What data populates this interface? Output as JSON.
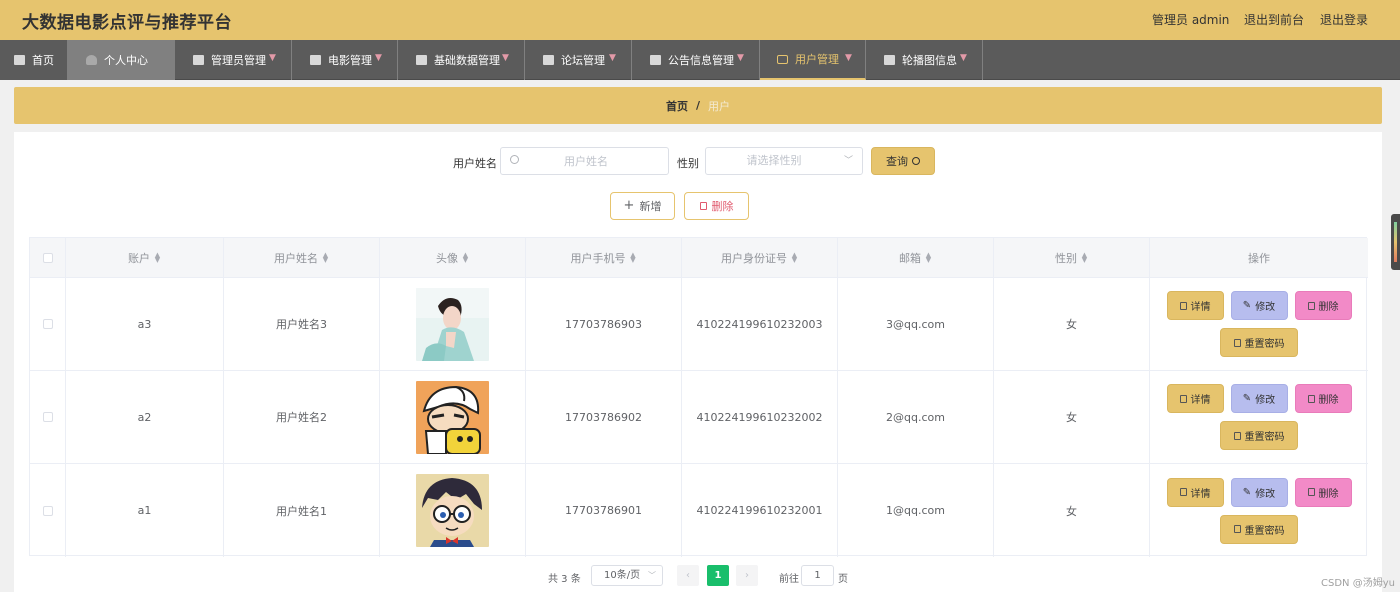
{
  "header": {
    "title": "大数据电影点评与推荐平台",
    "user": "管理员 admin",
    "front": "退出到前台",
    "logout": "退出登录"
  },
  "nav": {
    "items": [
      {
        "label": "首页",
        "icon": "home-icon"
      },
      {
        "label": "个人中心",
        "icon": "user-icon"
      },
      {
        "label": "管理员管理",
        "icon": "briefcase-icon"
      },
      {
        "label": "电影管理",
        "icon": "grid-icon"
      },
      {
        "label": "基础数据管理",
        "icon": "clipboard-icon"
      },
      {
        "label": "论坛管理",
        "icon": "forum-icon"
      },
      {
        "label": "公告信息管理",
        "icon": "notice-icon"
      },
      {
        "label": "用户管理",
        "icon": "mail-icon"
      },
      {
        "label": "轮播图信息",
        "icon": "chat-icon"
      }
    ]
  },
  "breadcrumb": {
    "home": "首页",
    "sep": "/",
    "current": "用户"
  },
  "search": {
    "name_label": "用户姓名",
    "name_placeholder": "用户姓名",
    "sex_label": "性别",
    "sex_placeholder": "请选择性别",
    "query_label": "查询"
  },
  "actions": {
    "add": "新增",
    "delete": "删除"
  },
  "table": {
    "headers": [
      "账户",
      "用户姓名",
      "头像",
      "用户手机号",
      "用户身份证号",
      "邮箱",
      "性别",
      "操作"
    ],
    "rows": [
      {
        "account": "a3",
        "name": "用户姓名3",
        "phone": "17703786903",
        "idcard": "410224199610232003",
        "email": "3@qq.com",
        "sex": "女",
        "avatar": "woman-photo"
      },
      {
        "account": "a2",
        "name": "用户姓名2",
        "phone": "17703786902",
        "idcard": "410224199610232002",
        "email": "2@qq.com",
        "sex": "女",
        "avatar": "cartoon-boy-backpack"
      },
      {
        "account": "a1",
        "name": "用户姓名1",
        "phone": "17703786901",
        "idcard": "410224199610232001",
        "email": "1@qq.com",
        "sex": "女",
        "avatar": "detective-boy-glasses"
      }
    ],
    "ops": {
      "detail": "详情",
      "edit": "修改",
      "delete": "删除",
      "reset": "重置密码"
    }
  },
  "pagination": {
    "total": "共 3 条",
    "page_size": "10条/页",
    "current": "1",
    "goto": "前往",
    "goto_value": "1",
    "unit": "页"
  },
  "watermark": "CSDN @汤姆yu",
  "colors": {
    "accent": "#e6c46e",
    "nav": "#5b5b5b",
    "edit": "#b7bdee",
    "delete": "#f28ac7",
    "page_active": "#19be6b"
  }
}
